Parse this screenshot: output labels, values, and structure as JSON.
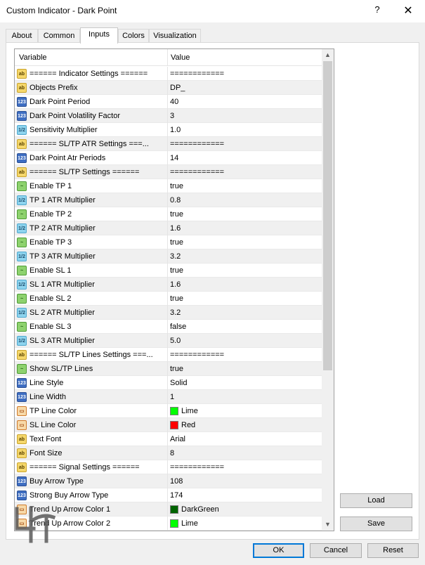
{
  "window": {
    "title": "Custom Indicator - Dark Point",
    "help_glyph": "?",
    "close_glyph": "✕"
  },
  "tabs": [
    {
      "label": "About"
    },
    {
      "label": "Common"
    },
    {
      "label": "Inputs"
    },
    {
      "label": "Colors"
    },
    {
      "label": "Visualization"
    }
  ],
  "grid": {
    "header_variable": "Variable",
    "header_value": "Value",
    "rows": [
      {
        "type": "string",
        "icon_text": "ab",
        "variable": "====== Indicator Settings ======",
        "value": "============"
      },
      {
        "type": "string",
        "icon_text": "ab",
        "variable": "Objects Prefix",
        "value": "DP_"
      },
      {
        "type": "int",
        "icon_text": "123",
        "variable": "Dark Point Period",
        "value": "40"
      },
      {
        "type": "int",
        "icon_text": "123",
        "variable": "Dark Point Volatility Factor",
        "value": "3"
      },
      {
        "type": "double",
        "icon_text": "1/2",
        "variable": "Sensitivity Multiplier",
        "value": "1.0"
      },
      {
        "type": "string",
        "icon_text": "ab",
        "variable": "====== SL/TP ATR Settings ===...",
        "value": "============"
      },
      {
        "type": "int",
        "icon_text": "123",
        "variable": "Dark Point Atr Periods",
        "value": "14"
      },
      {
        "type": "string",
        "icon_text": "ab",
        "variable": "====== SL/TP Settings ======",
        "value": "============"
      },
      {
        "type": "bool",
        "icon_text": "~",
        "variable": "Enable TP 1",
        "value": "true"
      },
      {
        "type": "double",
        "icon_text": "1/2",
        "variable": "TP 1 ATR Multiplier",
        "value": "0.8"
      },
      {
        "type": "bool",
        "icon_text": "~",
        "variable": "Enable TP 2",
        "value": "true"
      },
      {
        "type": "double",
        "icon_text": "1/2",
        "variable": "TP 2 ATR Multiplier",
        "value": "1.6"
      },
      {
        "type": "bool",
        "icon_text": "~",
        "variable": "Enable TP 3",
        "value": "true"
      },
      {
        "type": "double",
        "icon_text": "1/2",
        "variable": "TP 3 ATR Multiplier",
        "value": "3.2"
      },
      {
        "type": "bool",
        "icon_text": "~",
        "variable": "Enable SL 1",
        "value": "true"
      },
      {
        "type": "double",
        "icon_text": "1/2",
        "variable": "SL 1 ATR Multiplier",
        "value": "1.6"
      },
      {
        "type": "bool",
        "icon_text": "~",
        "variable": "Enable SL 2",
        "value": "true"
      },
      {
        "type": "double",
        "icon_text": "1/2",
        "variable": "SL 2 ATR Multiplier",
        "value": "3.2"
      },
      {
        "type": "bool",
        "icon_text": "~",
        "variable": "Enable SL 3",
        "value": "false"
      },
      {
        "type": "double",
        "icon_text": "1/2",
        "variable": "SL 3 ATR Multiplier",
        "value": "5.0"
      },
      {
        "type": "string",
        "icon_text": "ab",
        "variable": "====== SL/TP Lines Settings ===...",
        "value": "============"
      },
      {
        "type": "bool",
        "icon_text": "~",
        "variable": "Show SL/TP Lines",
        "value": "true"
      },
      {
        "type": "int",
        "icon_text": "123",
        "variable": "Line Style",
        "value": "Solid"
      },
      {
        "type": "int",
        "icon_text": "123",
        "variable": "Line Width",
        "value": "1"
      },
      {
        "type": "color",
        "icon_text": "▭",
        "variable": "TP Line Color",
        "value": "Lime",
        "swatch": "#00ff00"
      },
      {
        "type": "color",
        "icon_text": "▭",
        "variable": "SL Line Color",
        "value": "Red",
        "swatch": "#ff0000"
      },
      {
        "type": "string",
        "icon_text": "ab",
        "variable": "Text Font",
        "value": "Arial"
      },
      {
        "type": "string",
        "icon_text": "ab",
        "variable": "Font Size",
        "value": "8"
      },
      {
        "type": "string",
        "icon_text": "ab",
        "variable": "====== Signal Settings ======",
        "value": "============"
      },
      {
        "type": "int",
        "icon_text": "123",
        "variable": "Buy Arrow Type",
        "value": "108"
      },
      {
        "type": "int",
        "icon_text": "123",
        "variable": "Strong Buy Arrow Type",
        "value": "174"
      },
      {
        "type": "color",
        "icon_text": "▭",
        "variable": "Trend Up Arrow Color 1",
        "value": "DarkGreen",
        "swatch": "#006400"
      },
      {
        "type": "color",
        "icon_text": "▭",
        "variable": "Trend Up Arrow Color 2",
        "value": "Lime",
        "swatch": "#00ff00"
      }
    ]
  },
  "scrollbar": {
    "up_glyph": "▲",
    "down_glyph": "▼"
  },
  "buttons": {
    "load": "Load",
    "save": "Save",
    "ok": "OK",
    "cancel": "Cancel",
    "reset": "Reset"
  },
  "colors": {
    "accent": "#0078d7",
    "row_alt": "#f0f0f0"
  }
}
